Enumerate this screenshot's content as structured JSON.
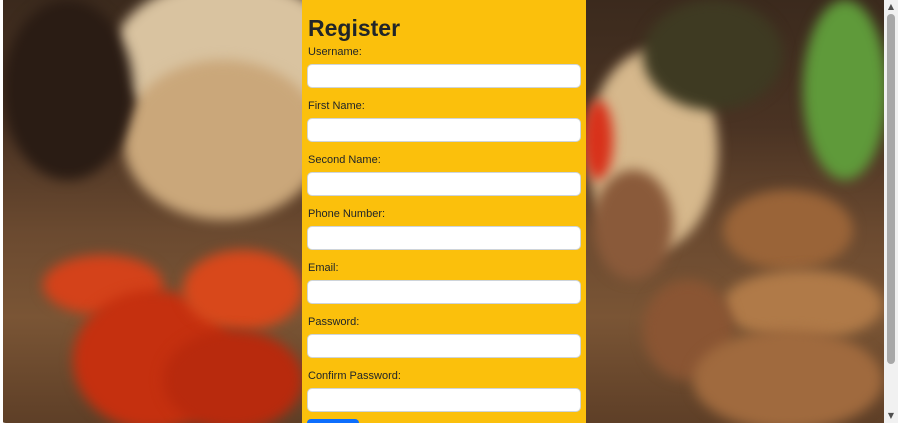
{
  "form": {
    "title": "Register",
    "fields": [
      {
        "label": "Username:",
        "value": ""
      },
      {
        "label": "First Name:",
        "value": ""
      },
      {
        "label": "Second Name:",
        "value": ""
      },
      {
        "label": "Phone Number:",
        "value": ""
      },
      {
        "label": "Email:",
        "value": ""
      },
      {
        "label": "Password:",
        "value": ""
      },
      {
        "label": "Confirm Password:",
        "value": ""
      }
    ],
    "submit_label": ""
  },
  "colors": {
    "panel": "#fbc00c",
    "input_bg": "#ffffff",
    "button": "#0d6efd"
  },
  "scrollbar": {
    "up_icon": "triangle-up-icon",
    "down_icon": "triangle-down-icon"
  }
}
